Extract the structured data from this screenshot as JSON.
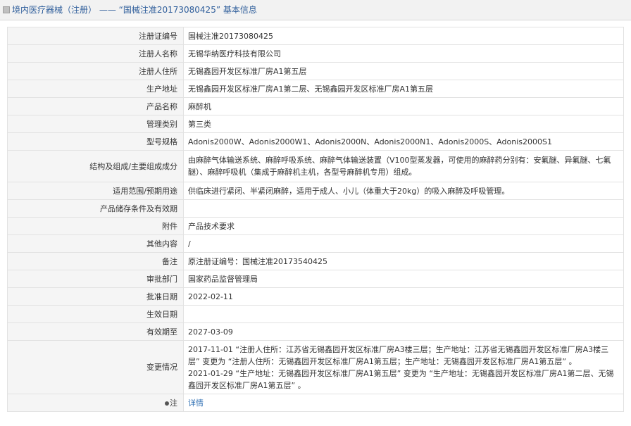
{
  "header": {
    "title": "境内医疗器械（注册） —— “国械注准20173080425” 基本信息"
  },
  "rows": [
    {
      "label": "注册证编号",
      "value": "国械注准20173080425"
    },
    {
      "label": "注册人名称",
      "value": "无锡华纳医疗科技有限公司"
    },
    {
      "label": "注册人住所",
      "value": "无锡鑫园开发区标准厂房A1第五层"
    },
    {
      "label": "生产地址",
      "value": "无锡鑫园开发区标准厂房A1第二层、无锡鑫园开发区标准厂房A1第五层"
    },
    {
      "label": "产品名称",
      "value": "麻醉机"
    },
    {
      "label": "管理类别",
      "value": "第三类"
    },
    {
      "label": "型号规格",
      "value": "Adonis2000W、Adonis2000W1、Adonis2000N、Adonis2000N1、Adonis2000S、Adonis2000S1"
    },
    {
      "label": "结构及组成/主要组成成分",
      "value": "由麻醉气体输送系统、麻醉呼吸系统、麻醉气体输送装置（V100型蒸发器，可使用的麻醉药分别有：安氟醚、异氟醚、七氟醚）、麻醉呼吸机（集成于麻醉机主机，各型号麻醉机专用）组成。"
    },
    {
      "label": "适用范围/预期用途",
      "value": "供临床进行紧闭、半紧闭麻醉，适用于成人、小儿（体重大于20kg）的吸入麻醉及呼吸管理。"
    },
    {
      "label": "产品储存条件及有效期",
      "value": ""
    },
    {
      "label": "附件",
      "value": "产品技术要求"
    },
    {
      "label": "其他内容",
      "value": "/"
    },
    {
      "label": "备注",
      "value": "原注册证编号：国械注准20173540425"
    },
    {
      "label": "审批部门",
      "value": "国家药品监督管理局"
    },
    {
      "label": "批准日期",
      "value": "2022-02-11"
    },
    {
      "label": "生效日期",
      "value": ""
    },
    {
      "label": "有效期至",
      "value": "2027-03-09"
    },
    {
      "label": "变更情况",
      "value_lines": [
        "2017-11-01 “注册人住所：江苏省无锡鑫园开发区标准厂房A3楼三层；生产地址：江苏省无锡鑫园开发区标准厂房A3楼三层” 变更为 “注册人住所：无锡鑫园开发区标准厂房A1第五层；生产地址：无锡鑫园开发区标准厂房A1第五层” 。",
        "2021-01-29 “生产地址：无锡鑫园开发区标准厂房A1第五层” 变更为 “生产地址：无锡鑫园开发区标准厂房A1第二层、无锡鑫园开发区标准厂房A1第五层” 。"
      ]
    },
    {
      "label": "注",
      "value": "详情"
    }
  ]
}
